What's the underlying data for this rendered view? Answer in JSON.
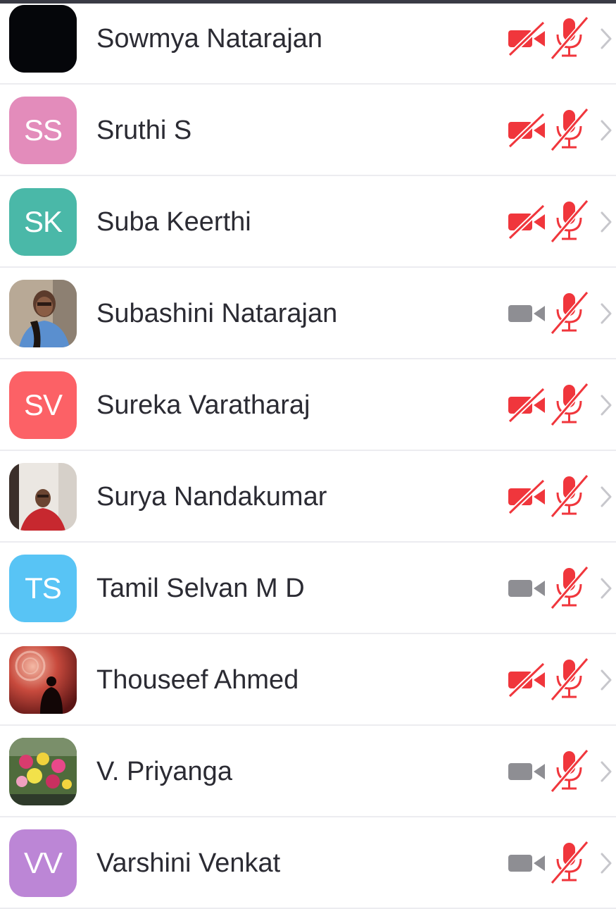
{
  "colors": {
    "muted_red": "#f0363c",
    "video_gray": "#8e8e93",
    "chevron": "#c7c7cc"
  },
  "participants": [
    {
      "name": "Sowmya Natarajan",
      "initials": "",
      "avatar_type": "dark-photo",
      "avatar_color": "#05060a",
      "video_on": false,
      "audio_on": false
    },
    {
      "name": "Sruthi S",
      "initials": "SS",
      "avatar_type": "initials",
      "avatar_color": "#e38cbb",
      "video_on": false,
      "audio_on": false
    },
    {
      "name": "Suba Keerthi",
      "initials": "SK",
      "avatar_type": "initials",
      "avatar_color": "#4ab8a8",
      "video_on": false,
      "audio_on": false
    },
    {
      "name": "Subashini Natarajan",
      "initials": "",
      "avatar_type": "photo-person-blue",
      "avatar_color": "#b7a897",
      "video_on": true,
      "audio_on": false
    },
    {
      "name": "Sureka Varatharaj",
      "initials": "SV",
      "avatar_type": "initials",
      "avatar_color": "#fc6166",
      "video_on": false,
      "audio_on": false
    },
    {
      "name": "Surya Nandakumar",
      "initials": "",
      "avatar_type": "photo-person-red",
      "avatar_color": "#e9e4df",
      "video_on": false,
      "audio_on": false
    },
    {
      "name": "Tamil Selvan M D",
      "initials": "TS",
      "avatar_type": "initials",
      "avatar_color": "#58c4f5",
      "video_on": true,
      "audio_on": false
    },
    {
      "name": "Thouseef Ahmed",
      "initials": "",
      "avatar_type": "photo-silhouette",
      "avatar_color": "#a4302a",
      "video_on": false,
      "audio_on": false
    },
    {
      "name": "V. Priyanga",
      "initials": "",
      "avatar_type": "photo-flowers",
      "avatar_color": "#5d7f47",
      "video_on": true,
      "audio_on": false
    },
    {
      "name": "Varshini Venkat",
      "initials": "VV",
      "avatar_type": "initials",
      "avatar_color": "#bc86d6",
      "video_on": true,
      "audio_on": false
    }
  ]
}
